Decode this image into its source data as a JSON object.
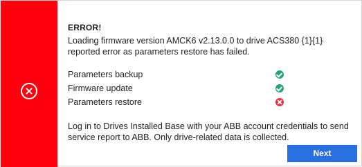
{
  "dialog": {
    "title": "ERROR!",
    "message": "Loading firmware version AMCK6 v2.13.0.0 to drive ACS380 {1}{1} reported error as parameters restore has failed.",
    "side_icon": "error-circle-x-icon",
    "accent_color": "#ff000f",
    "steps": [
      {
        "label": "Parameters backup",
        "status": "success",
        "icon": "check-circle-icon"
      },
      {
        "label": "Firmware update",
        "status": "success",
        "icon": "check-circle-icon"
      },
      {
        "label": "Parameters restore",
        "status": "failed",
        "icon": "x-circle-icon"
      }
    ],
    "info": "Log in to Drives Installed Base with your ABB account credentials to send service report to ABB. Only drive-related data is collected.",
    "next_label": "Next",
    "button_color": "#2a6fe0",
    "success_color": "#21a67a",
    "fail_color": "#f03040"
  }
}
